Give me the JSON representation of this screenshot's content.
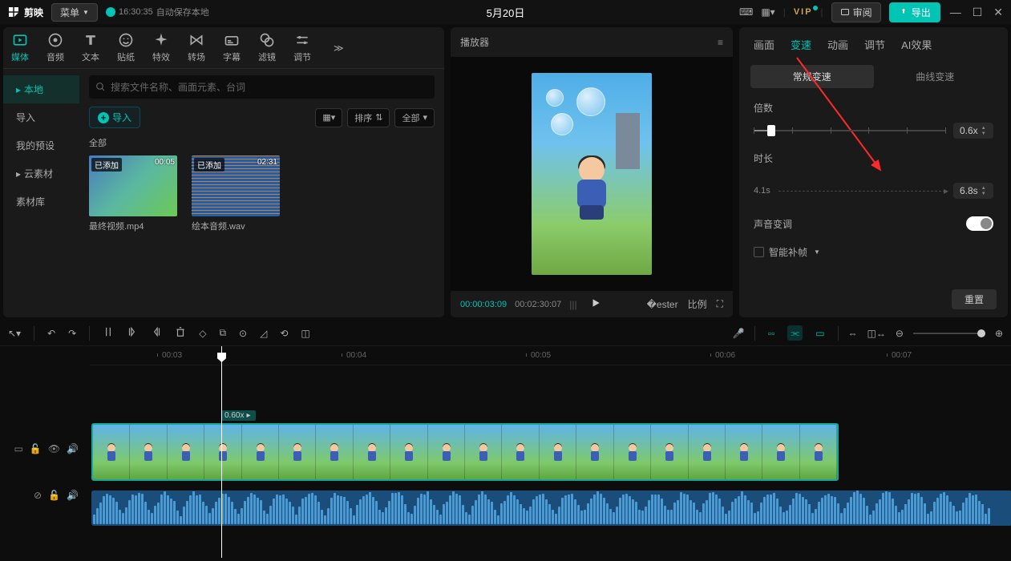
{
  "titlebar": {
    "logo": "剪映",
    "menu": "菜单",
    "autosave_time": "16:30:35",
    "autosave_text": "自动保存本地",
    "project_title": "5月20日",
    "vip": "VIP",
    "review": "审阅",
    "export": "导出"
  },
  "media": {
    "tabs": [
      "媒体",
      "音频",
      "文本",
      "贴纸",
      "特效",
      "转场",
      "字幕",
      "滤镜",
      "调节"
    ],
    "active_tab": 0,
    "side": {
      "local": "本地",
      "import": "导入",
      "preset": "我的预设",
      "cloud": "云素材",
      "lib": "素材库"
    },
    "search_placeholder": "搜索文件名称、画面元素、台词",
    "import_btn": "导入",
    "sort": "排序",
    "filter_all": "全部",
    "category": "全部",
    "thumbs": [
      {
        "badge": "已添加",
        "time": "00:05",
        "name": "最终视频.mp4"
      },
      {
        "badge": "已添加",
        "time": "02:31",
        "name": "绘本音频.wav"
      }
    ]
  },
  "player": {
    "title": "播放器",
    "time_cur": "00:00:03:09",
    "time_dur": "00:02:30:07",
    "ratio": "比例"
  },
  "props": {
    "tabs": [
      "画面",
      "变速",
      "动画",
      "调节",
      "AI效果"
    ],
    "active_tab": 1,
    "subtabs": [
      "常规变速",
      "曲线变速"
    ],
    "active_sub": 0,
    "multiplier_label": "倍数",
    "multiplier_value": "0.6x",
    "duration_label": "时长",
    "duration_orig": "4.1s",
    "duration_new": "6.8s",
    "pitch_label": "声音变调",
    "smartframe_label": "智能补帧",
    "reset": "重置"
  },
  "timeline": {
    "ruler": [
      "00:03",
      "00:04",
      "00:05",
      "00:06",
      "00:07"
    ],
    "clip_speed": "0.60x"
  }
}
